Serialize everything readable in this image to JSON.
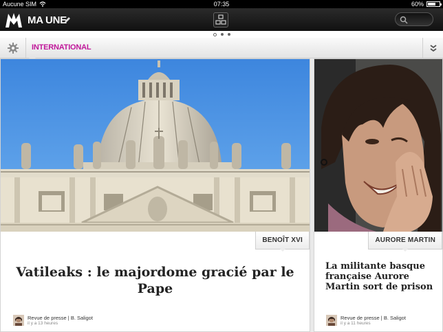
{
  "status_bar": {
    "carrier": "Aucune SIM",
    "time": "07:35",
    "battery": "60%",
    "battery_level": 0.6
  },
  "header": {
    "title": "MA UNE"
  },
  "pager": {
    "pages": 3,
    "current": 1
  },
  "section": {
    "label": "INTERNATIONAL"
  },
  "articles": [
    {
      "tag": "BENOÎT XVI",
      "headline": "Vatileaks : le majordome gracié par le Pape",
      "byline": "Revue de presse | B. Saligot",
      "time": "il y a 13 heures"
    },
    {
      "tag": "AURORE MARTIN",
      "headline": "La militante basque française Aurore Martin sort de prison",
      "byline": "Revue de presse | B. Saligot",
      "time": "il y a 11 heures"
    }
  ],
  "colors": {
    "accent": "#c0179a",
    "sky": "#4a8fdc"
  }
}
